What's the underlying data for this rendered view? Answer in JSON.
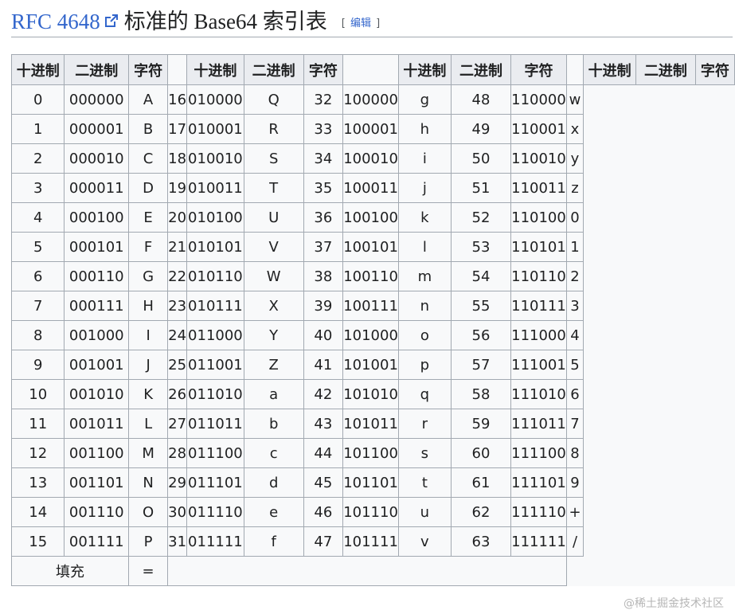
{
  "header": {
    "title_link": "RFC 4648",
    "title_rest": "标准的 Base64 索引表",
    "edit_bracket_open": "[",
    "edit_label": "编辑",
    "edit_bracket_close": "]"
  },
  "table": {
    "headers": [
      "十进制",
      "二进制",
      "字符"
    ],
    "rows": [
      [
        [
          "0",
          "000000",
          "A"
        ],
        [
          "16",
          "010000",
          "Q"
        ],
        [
          "32",
          "100000",
          "g"
        ],
        [
          "48",
          "110000",
          "w"
        ]
      ],
      [
        [
          "1",
          "000001",
          "B"
        ],
        [
          "17",
          "010001",
          "R"
        ],
        [
          "33",
          "100001",
          "h"
        ],
        [
          "49",
          "110001",
          "x"
        ]
      ],
      [
        [
          "2",
          "000010",
          "C"
        ],
        [
          "18",
          "010010",
          "S"
        ],
        [
          "34",
          "100010",
          "i"
        ],
        [
          "50",
          "110010",
          "y"
        ]
      ],
      [
        [
          "3",
          "000011",
          "D"
        ],
        [
          "19",
          "010011",
          "T"
        ],
        [
          "35",
          "100011",
          "j"
        ],
        [
          "51",
          "110011",
          "z"
        ]
      ],
      [
        [
          "4",
          "000100",
          "E"
        ],
        [
          "20",
          "010100",
          "U"
        ],
        [
          "36",
          "100100",
          "k"
        ],
        [
          "52",
          "110100",
          "0"
        ]
      ],
      [
        [
          "5",
          "000101",
          "F"
        ],
        [
          "21",
          "010101",
          "V"
        ],
        [
          "37",
          "100101",
          "l"
        ],
        [
          "53",
          "110101",
          "1"
        ]
      ],
      [
        [
          "6",
          "000110",
          "G"
        ],
        [
          "22",
          "010110",
          "W"
        ],
        [
          "38",
          "100110",
          "m"
        ],
        [
          "54",
          "110110",
          "2"
        ]
      ],
      [
        [
          "7",
          "000111",
          "H"
        ],
        [
          "23",
          "010111",
          "X"
        ],
        [
          "39",
          "100111",
          "n"
        ],
        [
          "55",
          "110111",
          "3"
        ]
      ],
      [
        [
          "8",
          "001000",
          "I"
        ],
        [
          "24",
          "011000",
          "Y"
        ],
        [
          "40",
          "101000",
          "o"
        ],
        [
          "56",
          "111000",
          "4"
        ]
      ],
      [
        [
          "9",
          "001001",
          "J"
        ],
        [
          "25",
          "011001",
          "Z"
        ],
        [
          "41",
          "101001",
          "p"
        ],
        [
          "57",
          "111001",
          "5"
        ]
      ],
      [
        [
          "10",
          "001010",
          "K"
        ],
        [
          "26",
          "011010",
          "a"
        ],
        [
          "42",
          "101010",
          "q"
        ],
        [
          "58",
          "111010",
          "6"
        ]
      ],
      [
        [
          "11",
          "001011",
          "L"
        ],
        [
          "27",
          "011011",
          "b"
        ],
        [
          "43",
          "101011",
          "r"
        ],
        [
          "59",
          "111011",
          "7"
        ]
      ],
      [
        [
          "12",
          "001100",
          "M"
        ],
        [
          "28",
          "011100",
          "c"
        ],
        [
          "44",
          "101100",
          "s"
        ],
        [
          "60",
          "111100",
          "8"
        ]
      ],
      [
        [
          "13",
          "001101",
          "N"
        ],
        [
          "29",
          "011101",
          "d"
        ],
        [
          "45",
          "101101",
          "t"
        ],
        [
          "61",
          "111101",
          "9"
        ]
      ],
      [
        [
          "14",
          "001110",
          "O"
        ],
        [
          "30",
          "011110",
          "e"
        ],
        [
          "46",
          "101110",
          "u"
        ],
        [
          "62",
          "111110",
          "+"
        ]
      ],
      [
        [
          "15",
          "001111",
          "P"
        ],
        [
          "31",
          "011111",
          "f"
        ],
        [
          "47",
          "101111",
          "v"
        ],
        [
          "63",
          "111111",
          "/"
        ]
      ]
    ],
    "padding_label": "填充",
    "padding_char": "="
  },
  "watermark": "@稀土掘金技术社区",
  "icons": {
    "external_link": "external-link-icon"
  },
  "colors": {
    "link": "#3366cc",
    "header_bg": "#eaecf0",
    "cell_bg": "#f8f9fa",
    "border": "#a2a9b1"
  }
}
